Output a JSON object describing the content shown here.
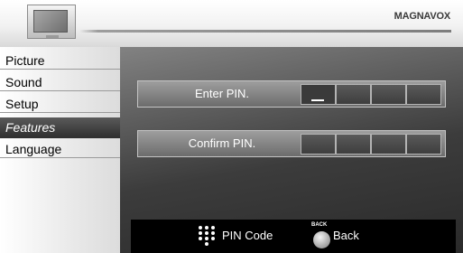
{
  "header": {
    "brand": "MAGNAVOX",
    "icon": "tv-icon"
  },
  "sidebar": {
    "items": [
      {
        "label": "Picture"
      },
      {
        "label": "Sound"
      },
      {
        "label": "Setup"
      },
      {
        "label": "Features",
        "active": true
      },
      {
        "label": "Language"
      }
    ]
  },
  "main": {
    "enter_pin_label": "Enter PIN.",
    "confirm_pin_label": "Confirm PIN.",
    "cursor_glyph": "_"
  },
  "footer": {
    "pin_code_label": "PIN Code",
    "back_key_label": "BACK",
    "back_label": "Back"
  },
  "colors": {
    "active_item": "#3c3c3c",
    "panel": "#555555",
    "footer": "#000000"
  }
}
